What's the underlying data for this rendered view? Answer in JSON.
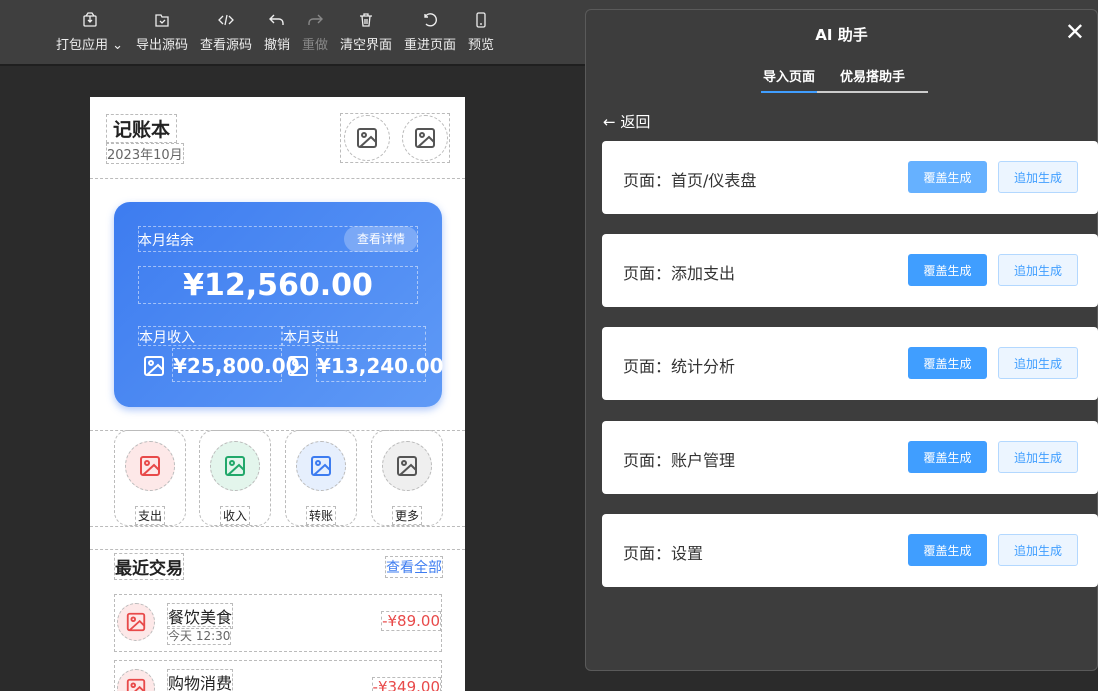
{
  "toolbar": {
    "items": [
      {
        "label": "打包应用",
        "icon": "package-icon"
      },
      {
        "label": "导出源码",
        "icon": "folder-check-icon"
      },
      {
        "label": "查看源码",
        "icon": "code-icon"
      },
      {
        "label": "撤销",
        "icon": "undo-icon"
      },
      {
        "label": "重做",
        "icon": "redo-icon"
      },
      {
        "label": "清空界面",
        "icon": "trash-icon"
      },
      {
        "label": "重进页面",
        "icon": "refresh-icon"
      },
      {
        "label": "预览",
        "icon": "phone-icon"
      }
    ]
  },
  "app": {
    "title": "记账本",
    "subtitle": "2023年10月",
    "balance": {
      "label": "本月结余",
      "detail": "查看详情",
      "amount": "¥12,560.00",
      "income_label": "本月收入",
      "income": "¥25,800.00",
      "expense_label": "本月支出",
      "expense": "¥13,240.00"
    },
    "quick": [
      {
        "label": "支出",
        "color": "#e84a4a",
        "bg": "#fde8e8"
      },
      {
        "label": "收入",
        "color": "#22a86b",
        "bg": "#e3f5ec"
      },
      {
        "label": "转账",
        "color": "#3d7cf0",
        "bg": "#e6effd"
      },
      {
        "label": "更多",
        "color": "#555555",
        "bg": "#efefef"
      }
    ],
    "recent": {
      "title": "最近交易",
      "view_all": "查看全部",
      "items": [
        {
          "name": "餐饮美食",
          "time": "今天 12:30",
          "amount": "-¥89.00"
        },
        {
          "name": "购物消费",
          "amount": "-¥349.00"
        }
      ]
    }
  },
  "panel": {
    "title": "AI 助手",
    "tabs": [
      "导入页面",
      "优易搭助手"
    ],
    "back": "返回",
    "overwrite": "覆盖生成",
    "append": "追加生成",
    "pages": [
      "页面：首页/仪表盘",
      "页面：添加支出",
      "页面：统计分析",
      "页面：账户管理",
      "页面：设置"
    ]
  }
}
